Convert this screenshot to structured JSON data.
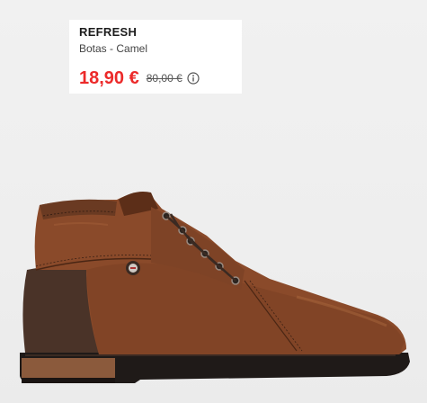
{
  "product": {
    "brand": "REFRESH",
    "subtitle": "Botas - Camel",
    "price": "18,90 €",
    "old_price": "80,00 €",
    "info_icon": "info-circle-icon"
  },
  "image": {
    "subject": "brown-leather-lace-up-ankle-boot",
    "colors": {
      "leather": "#8a4a2a",
      "leather_dark": "#5c2e18",
      "heel_counter": "#4a3328",
      "sole": "#1f1a18",
      "sole_edge": "#8b5a3c"
    }
  }
}
